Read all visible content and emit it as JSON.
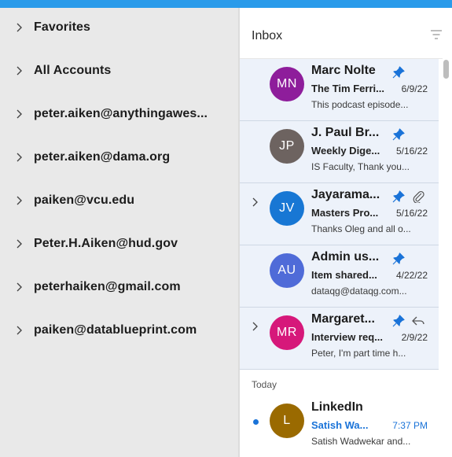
{
  "colors": {
    "accent": "#2a9bea",
    "pin": "#1a73d8",
    "selected_row_bg": "#edf2fa",
    "sidebar_bg": "#e9e9e9"
  },
  "sidebar": {
    "items": [
      {
        "label": "Favorites"
      },
      {
        "label": "All Accounts"
      },
      {
        "label": "peter.aiken@anythingawes..."
      },
      {
        "label": "peter.aiken@dama.org"
      },
      {
        "label": "paiken@vcu.edu"
      },
      {
        "label": "Peter.H.Aiken@hud.gov"
      },
      {
        "label": "peterhaiken@gmail.com"
      },
      {
        "label": "paiken@datablueprint.com"
      }
    ]
  },
  "inbox": {
    "title": "Inbox",
    "filter_icon": "filter-lines-icon",
    "section_today": "Today",
    "messages": [
      {
        "initials": "MN",
        "avatar_color": "#8e1d9b",
        "sender": "Marc Nolte",
        "subject": "The Tim Ferri...",
        "date": "6/9/22",
        "preview": "This podcast episode...",
        "pinned": true
      },
      {
        "initials": "JP",
        "avatar_color": "#6d6360",
        "sender": "J. Paul Br...",
        "subject": "Weekly Dige...",
        "date": "5/16/22",
        "preview": "IS Faculty, Thank you...",
        "pinned": true
      },
      {
        "initials": "JV",
        "avatar_color": "#1877d4",
        "sender": "Jayarama...",
        "subject": "Masters Pro...",
        "date": "5/16/22",
        "preview": "Thanks Oleg and all o...",
        "pinned": true,
        "attachment": true,
        "thread": true
      },
      {
        "initials": "AU",
        "avatar_color": "#4f6bd8",
        "sender": "Admin us...",
        "subject": "Item shared...",
        "date": "4/22/22",
        "preview": "dataqg@dataqg.com...",
        "pinned": true
      },
      {
        "initials": "MR",
        "avatar_color": "#d6187a",
        "sender": "Margaret...",
        "subject": "Interview req...",
        "date": "2/9/22",
        "preview": "Peter, I'm part time h...",
        "pinned": true,
        "replied": true,
        "thread": true
      },
      {
        "initials": "L",
        "avatar_color": "#9a6a00",
        "sender": "LinkedIn",
        "subject": "Satish Wa...",
        "date": "7:37 PM",
        "preview": "Satish Wadwekar and...",
        "unread": true
      }
    ]
  }
}
